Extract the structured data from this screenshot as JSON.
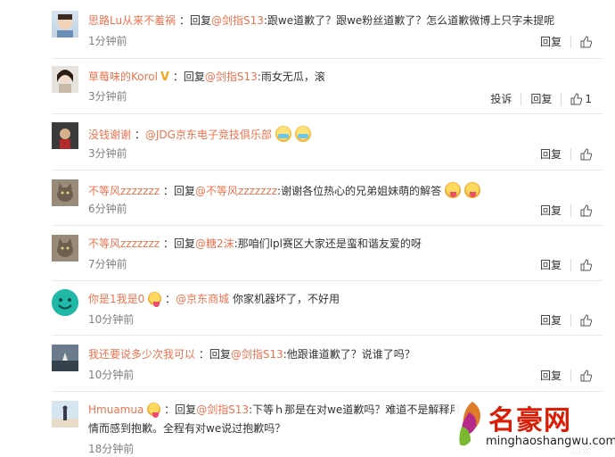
{
  "comments": [
    {
      "user": "思路Lu从来不羞祸",
      "sep": "：",
      "reply_prefix": "回复",
      "mention": "@剑指S13",
      "text": ":跟we道歉了？跟we粉丝道歉了？怎么道歉微博上只字未提呢",
      "time": "1分钟前",
      "reply_label": "回复"
    },
    {
      "user": "草莓味的Korol",
      "badge": "V",
      "sep": "：",
      "reply_prefix": "回复",
      "mention": "@剑指S13",
      "text": ":雨女无瓜，滚",
      "time": "3分钟前",
      "report_label": "投诉",
      "reply_label": "回复",
      "like_count": "1"
    },
    {
      "user": "没钱谢谢",
      "sep": "：",
      "mention": "@JDG京东电子竞技俱乐部",
      "time": "3分钟前",
      "reply_label": "回复"
    },
    {
      "user": "不等风zzzzzzz",
      "sep": "：",
      "reply_prefix": "回复",
      "mention": "@不等风zzzzzzz",
      "text": ":谢谢各位热心的兄弟姐妹萌的解答",
      "time": "6分钟前",
      "reply_label": "回复"
    },
    {
      "user": "不等风zzzzzzz",
      "sep": "：",
      "reply_prefix": "回复",
      "mention": "@糖2沫",
      "text": ":那咱们lpl赛区大家还是蛮和谐友爱的呀",
      "time": "7分钟前",
      "reply_label": "回复"
    },
    {
      "user": "你是1我是0",
      "sep": "：",
      "mention": "@京东商城",
      "text": "你家机器坏了，不好用",
      "time": "10分钟前",
      "reply_label": "回复"
    },
    {
      "user": "我还要说多少次我可以",
      "sep": "：",
      "reply_prefix": "回复",
      "mention": "@剑指S13",
      "text": ":他跟谁道歉了？说谁了吗？",
      "time": "10分钟前",
      "reply_label": "回复"
    },
    {
      "user": "Hmuamua",
      "sep": "：",
      "reply_prefix": "回复",
      "mention": "@剑指S13",
      "text": ":下等ｈ那是在对we道歉吗？难道不是解释用",
      "text2": "情而感到抱歉。全程有对we说过抱歉吗？",
      "time": "18分钟前",
      "reply_label": "回复"
    }
  ],
  "watermark": {
    "title": "名豪网",
    "url": "minghaoshangwu.com"
  },
  "colors": {
    "username": "#eb7350",
    "time": "#808080",
    "divider": "#e9e9e9",
    "watermark_red": "#d81e06"
  }
}
